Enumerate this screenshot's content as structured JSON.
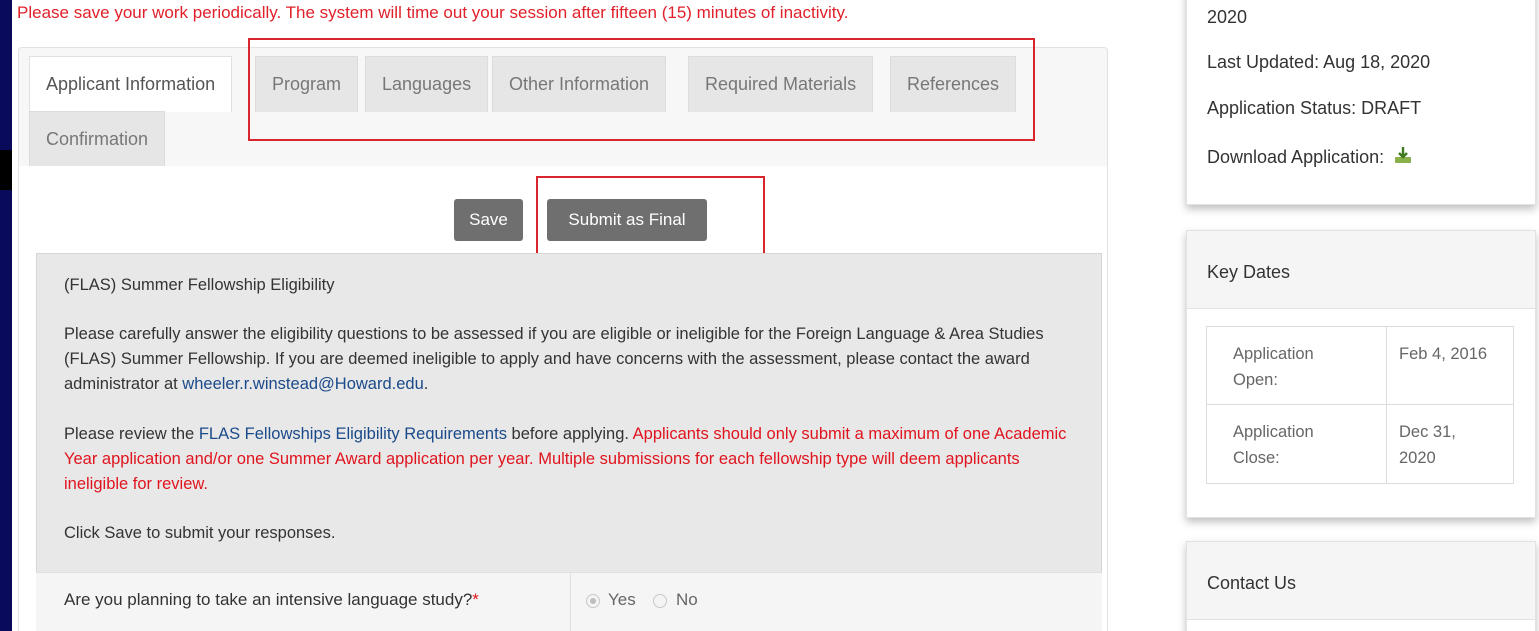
{
  "notice": "Please save your work periodically. The system will time out your session after fifteen (15) minutes of inactivity.",
  "tabs": [
    {
      "label": "Applicant Information",
      "active": true
    },
    {
      "label": "Program",
      "active": false
    },
    {
      "label": "Languages",
      "active": false
    },
    {
      "label": "Other Information",
      "active": false
    },
    {
      "label": "Required Materials",
      "active": false
    },
    {
      "label": "References",
      "active": false
    },
    {
      "label": "Confirmation",
      "active": false
    }
  ],
  "actions": {
    "save_label": "Save",
    "submit_label": "Submit as Final"
  },
  "eligibility": {
    "title": "(FLAS) Summer Fellowship Eligibility",
    "intro_1": "Please carefully answer the eligibility questions to be assessed if you are eligible or ineligible for the Foreign Language & Area Studies (FLAS) Summer Fellowship. If you are deemed ineligible to apply and have concerns with the assessment, please contact the award administrator at ",
    "email": "wheeler.r.winstead@Howard.edu",
    "intro_1_end": ".",
    "review_prefix": "Please review the ",
    "review_link": "FLAS Fellowships Eligibility Requirements",
    "review_mid": " before applying. ",
    "warning": "Applicants should only submit a maximum of one Academic Year application and/or one Summer Award application per year. Multiple submissions for each fellowship type will deem applicants ineligible for review.",
    "save_hint": "Click Save to submit your responses."
  },
  "question": {
    "text": "Are you planning to take an intensive language study?",
    "required_mark": "*",
    "options": [
      "Yes",
      "No"
    ],
    "selected": "Yes"
  },
  "status_card": {
    "year_fragment": "2020",
    "last_updated_label": "Last Updated:",
    "last_updated_value": "Aug 18, 2020",
    "status_label": "Application Status:",
    "status_value": "DRAFT",
    "download_label": "Download Application:",
    "download_icon": "download-icon"
  },
  "key_dates": {
    "title": "Key Dates",
    "rows": [
      {
        "label_line1": "Application",
        "label_line2": "Open:",
        "value_line1": "Feb 4, 2016",
        "value_line2": ""
      },
      {
        "label_line1": "Application",
        "label_line2": "Close:",
        "value_line1": "Dec 31,",
        "value_line2": "2020"
      }
    ]
  },
  "contact": {
    "title": "Contact Us"
  },
  "colors": {
    "frame": "#0a0a5a",
    "highlight_box": "#d9262e",
    "warning_text": "#e0141e",
    "link": "#1a4a8a",
    "button": "#6f6f6f"
  }
}
